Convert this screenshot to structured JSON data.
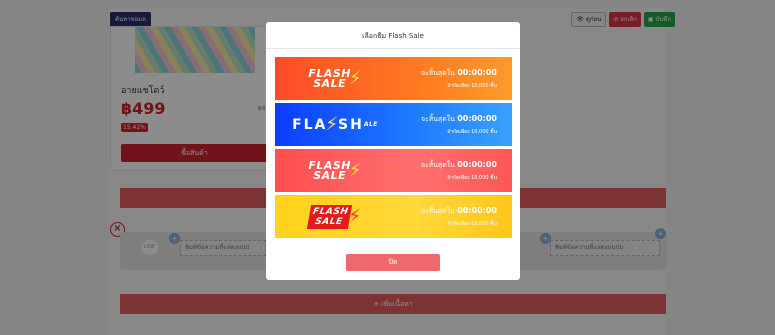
{
  "background": {
    "search_button": "ค้นหาขอมล",
    "preview_button": "ดูก่อน",
    "cancel_button": "ยกเลิก",
    "save_button": "บันทึก",
    "product": {
      "name": "อายแชโดว์",
      "price": "฿499",
      "old_price": "฿6",
      "discount": "15.42%",
      "buy_label": "ซื้อสินค้า"
    },
    "line_icon": "LINE",
    "message_placeholder_left": "พิมพ์ข้อความที่แสดงบนป่",
    "message_placeholder_right": "พิมพ์ข้อความที่แสดงบนป่ม",
    "add_content_label": "+ เพิ่มเนื้อหา"
  },
  "modal": {
    "title": "เลือกธีม Flash Sale",
    "options": [
      {
        "logo_line1": "FLASH",
        "logo_line2": "SALE",
        "ends_label": "จะสิ้นสุดใน",
        "countdown": "00:00:00",
        "limit": "จำกัดเพียง 10,000 ชิ้น"
      },
      {
        "logo_line1": "FLA",
        "logo_line2": "SH",
        "logo_sub": "ALE",
        "ends_label": "จะสิ้นสุดใน",
        "countdown": "00:00:00",
        "limit": "จำกัดเพียง 10,000 ชิ้น"
      },
      {
        "logo_line1": "FLASH",
        "logo_line2": "SALE",
        "ends_label": "จะสิ้นสุดใน",
        "countdown": "00:00:00",
        "limit": "จำกัดเพียง 10,000 ชิ้น"
      },
      {
        "logo_line1": "FLASH",
        "logo_line2": "SALE",
        "ends_label": "จะสิ้นสุดใน",
        "countdown": "00:00:00",
        "limit": "จำกัดเพียง 10,000 ชิ้น"
      }
    ],
    "close_label": "ปิด"
  }
}
